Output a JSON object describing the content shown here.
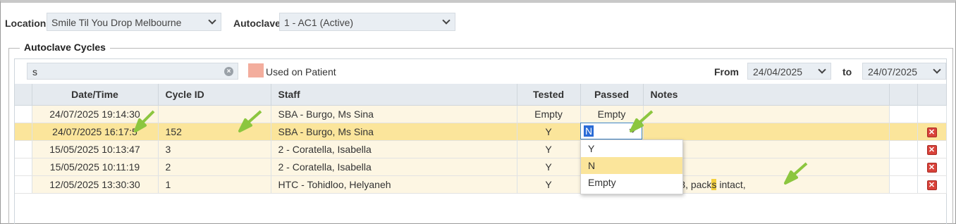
{
  "filters": {
    "location_label": "Location",
    "location_value": "Smile Til You Drop Melbourne",
    "autoclave_label": "Autoclave",
    "autoclave_value": "1 - AC1 (Active)"
  },
  "section_title": "Autoclave Cycles",
  "toolbar": {
    "search_value": "s",
    "legend_label": "Used on Patient",
    "legend_color": "#f3ad9d",
    "from_label": "From",
    "from_value": "24/04/2025",
    "to_label": "to",
    "to_value": "24/07/2025"
  },
  "table": {
    "headers": [
      "Date/Time",
      "Cycle ID",
      "Staff",
      "Tested",
      "Passed",
      "Notes"
    ],
    "rows": [
      {
        "datetime": "24/07/2025 19:14:30",
        "cycle_id": "",
        "staff": "SBA - Burgo, Ms Sina",
        "tested": "Empty",
        "passed": "Empty",
        "notes": ""
      },
      {
        "datetime": "24/07/2025 16:17:5",
        "cycle_id": "152",
        "staff": "SBA - Burgo, Ms Sina",
        "tested": "Y",
        "passed": "N",
        "notes": ""
      },
      {
        "datetime": "15/05/2025 10:13:47",
        "cycle_id": "3",
        "staff": "2 - Coratella, Isabella",
        "tested": "Y",
        "passed": "",
        "notes": ""
      },
      {
        "datetime": "15/05/2025 10:11:19",
        "cycle_id": "2",
        "staff": "2 - Coratella, Isabella",
        "tested": "Y",
        "passed": "",
        "notes": ""
      },
      {
        "datetime": "12/05/2025 13:30:30",
        "cycle_id": "1",
        "staff": "HTC - Tohidloo, Helyaneh",
        "tested": "Y",
        "passed": "",
        "notes_a": "73, pack",
        "notes_hl": "s",
        "notes_b": " intact,"
      }
    ]
  },
  "editor": {
    "value": "N",
    "options": [
      "Y",
      "N",
      "Empty"
    ],
    "highlighted": "N"
  },
  "colors": {
    "selected_row": "#fbe59b",
    "row_tint": "#fdf6e3",
    "arrow": "#8cc63f",
    "delete": "#d9423a"
  }
}
